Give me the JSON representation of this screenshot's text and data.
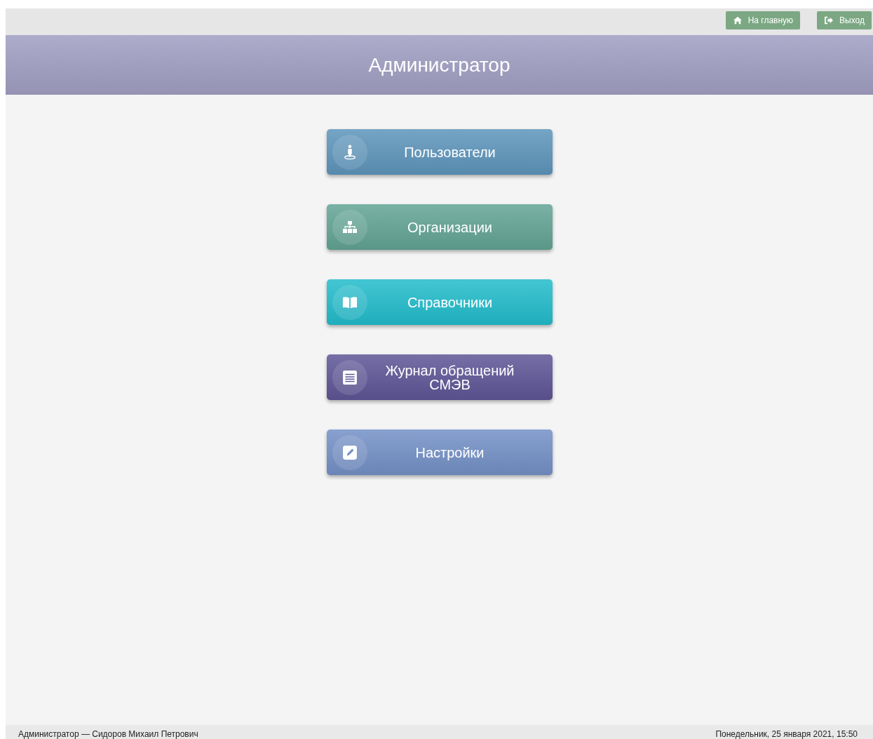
{
  "top_bar": {
    "buttons": [
      {
        "label": "На главную",
        "kind": "home"
      },
      {
        "label": "Выход",
        "kind": "exit"
      }
    ]
  },
  "header": {
    "title": "Администратор"
  },
  "menu": [
    {
      "label": "Пользователи",
      "kind": "user",
      "color": "#5d95bb"
    },
    {
      "label": "Организации",
      "kind": "org",
      "color": "#62a494"
    },
    {
      "label": "Справочники",
      "kind": "book",
      "color": "#22bccb"
    },
    {
      "label": "Журнал обращений СМЭВ",
      "kind": "list",
      "color": "#5e5596"
    },
    {
      "label": "Настройки",
      "kind": "edit",
      "color": "#7390c6"
    }
  ],
  "status_bar": {
    "user": "Администратор — Сидоров Михаил Петрович",
    "datetime": "Понедельник, 25 января 2021, 15:50"
  }
}
